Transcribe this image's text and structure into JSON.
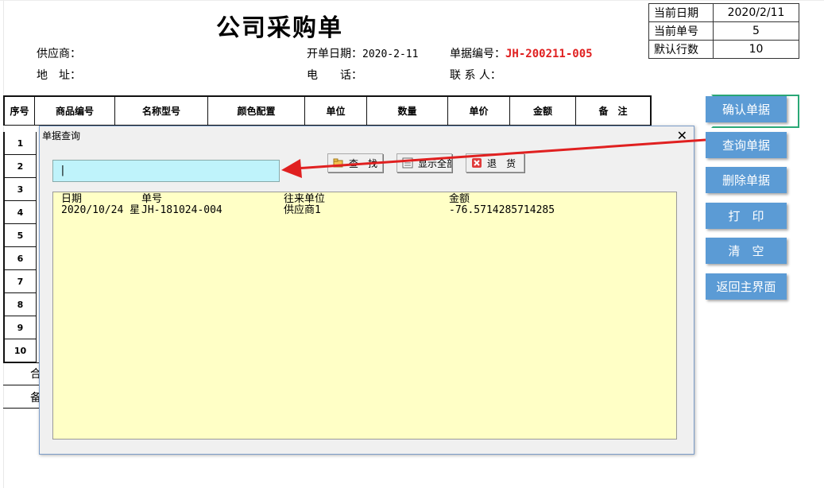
{
  "form": {
    "title": "公司采购单",
    "supplier_label": "供应商：",
    "address_label": "地　址：",
    "open_date_label": "开单日期：",
    "open_date_value": "2020-2-11",
    "phone_label": "电　　话：",
    "doc_no_label": "单据编号：",
    "doc_no_value": "JH-200211-005",
    "contact_label": "联 系 人："
  },
  "info": {
    "rows": [
      {
        "label": "当前日期",
        "value": "2020/2/11"
      },
      {
        "label": "当前单号",
        "value": "5"
      },
      {
        "label": "默认行数",
        "value": "10"
      }
    ]
  },
  "table": {
    "headers": [
      "序号",
      "商品编号",
      "名称型号",
      "颜色配置",
      "单位",
      "数量",
      "单价",
      "金额",
      "备　注"
    ],
    "row_numbers": [
      "1",
      "2",
      "3",
      "4",
      "5",
      "6",
      "7",
      "8",
      "9",
      "10"
    ],
    "total_label_partial": "合",
    "remark_label_partial": "备"
  },
  "side_buttons": [
    "确认单据",
    "查询单据",
    "删除单据",
    "打　印",
    "清　空",
    "返回主界面"
  ],
  "dialog": {
    "title": "单据查询",
    "close": "✕",
    "search_value": "|",
    "buttons": {
      "find": "查　找",
      "show_all": "显示全部",
      "return_goods": "退　货"
    },
    "list": {
      "columns": [
        "日期",
        "单号",
        "往来单位",
        "金额"
      ],
      "rows": [
        {
          "date": "2020/10/24 星",
          "number": "JH-181024-004",
          "unit": "供应商1",
          "amount": "-76.5714285714285"
        }
      ]
    }
  },
  "colors": {
    "accent_button": "#5b9bd5",
    "doc_no": "#e02020",
    "search_bg": "#bff3fb",
    "list_bg": "#ffffc6",
    "arrow": "#e02020",
    "highlight_border": "#2aa876"
  }
}
